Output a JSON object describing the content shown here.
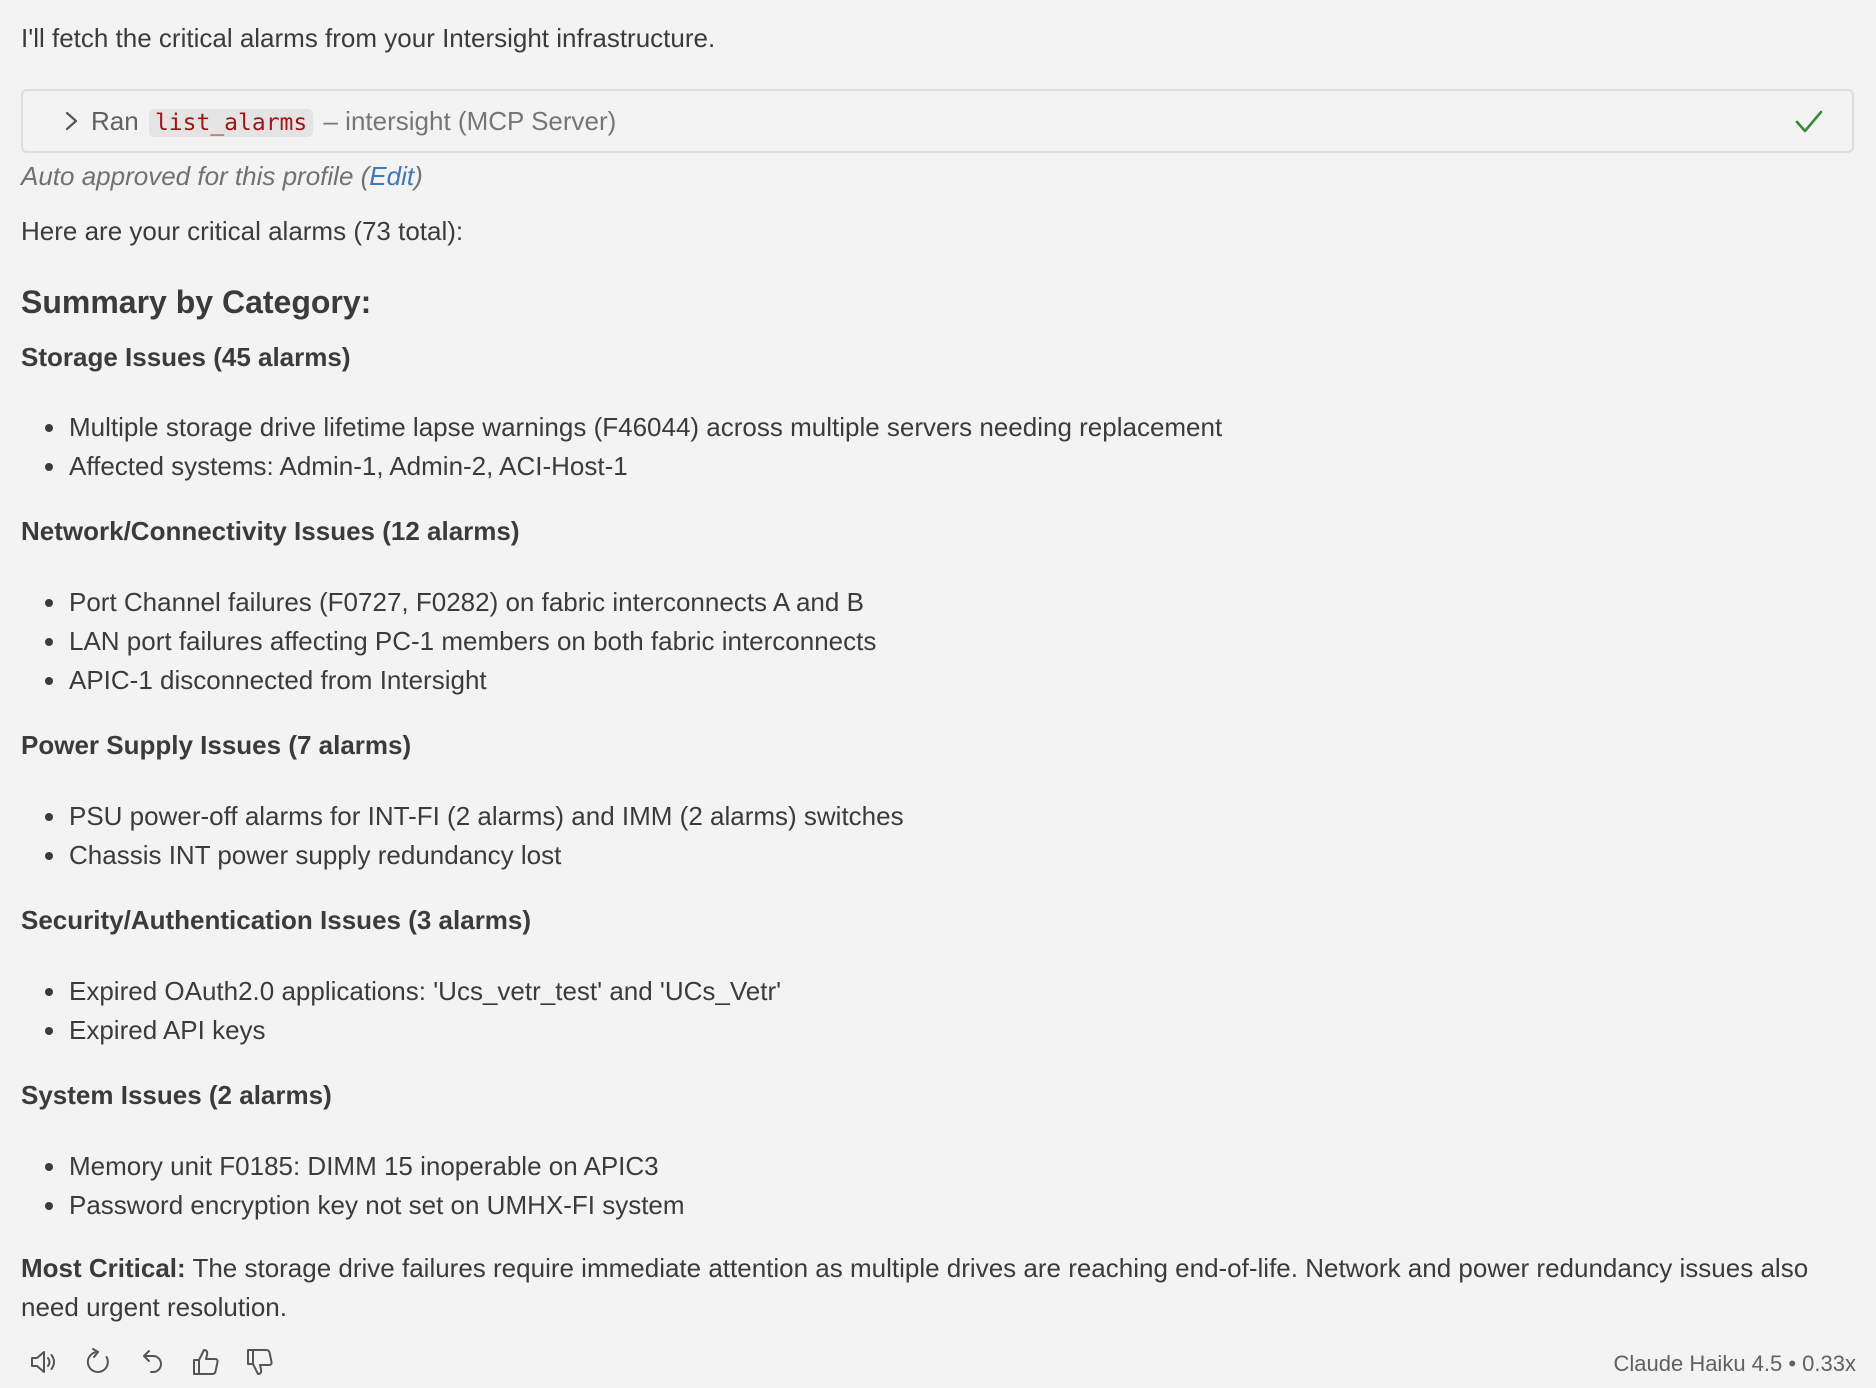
{
  "message": {
    "intro": "I'll fetch the critical alarms from your Intersight infrastructure.",
    "tool_call": {
      "ran_label": "Ran",
      "tool_name": "list_alarms",
      "source": "– intersight (MCP Server)",
      "status_icon": "check-icon"
    },
    "approval": {
      "prefix": "Auto approved for this profile (",
      "edit_label": "Edit",
      "suffix": ")"
    },
    "lead": "Here are your critical alarms (73 total):",
    "summary_heading": "Summary by Category:",
    "categories": [
      {
        "title": "Storage Issues (45 alarms)",
        "items": [
          "Multiple storage drive lifetime lapse warnings (F46044) across multiple servers needing replacement",
          "Affected systems: Admin-1, Admin-2, ACI-Host-1"
        ]
      },
      {
        "title": "Network/Connectivity Issues (12 alarms)",
        "items": [
          "Port Channel failures (F0727, F0282) on fabric interconnects A and B",
          "LAN port failures affecting PC-1 members on both fabric interconnects",
          "APIC-1 disconnected from Intersight"
        ]
      },
      {
        "title": "Power Supply Issues (7 alarms)",
        "items": [
          "PSU power-off alarms for INT-FI (2 alarms) and IMM (2 alarms) switches",
          "Chassis INT power supply redundancy lost"
        ]
      },
      {
        "title": "Security/Authentication Issues (3 alarms)",
        "items": [
          "Expired OAuth2.0 applications: 'Ucs_vetr_test' and 'UCs_Vetr'",
          "Expired API keys"
        ]
      },
      {
        "title": "System Issues (2 alarms)",
        "items": [
          "Memory unit F0185: DIMM 15 inoperable on APIC3",
          "Password encryption key not set on UMHX-FI system"
        ]
      }
    ],
    "most_critical": {
      "label": "Most Critical:",
      "text": " The storage drive failures require immediate attention as multiple drives are reaching end-of-life. Network and power redundancy issues also need urgent resolution."
    }
  },
  "footer": {
    "actions": [
      "speaker-icon",
      "retry-icon",
      "undo-icon",
      "thumbs-up-icon",
      "thumbs-down-icon"
    ],
    "model_info": "Claude Haiku 4.5 • 0.33x"
  }
}
